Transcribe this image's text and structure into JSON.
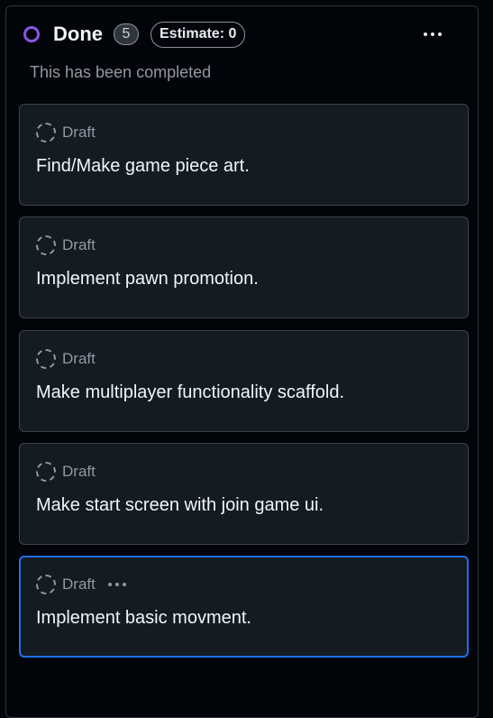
{
  "column": {
    "title": "Done",
    "count": "5",
    "estimate": "Estimate: 0",
    "description": "This has been completed",
    "status_color": "#8957e5"
  },
  "cards": [
    {
      "status": "Draft",
      "title": "Find/Make game piece art."
    },
    {
      "status": "Draft",
      "title": "Implement pawn promotion."
    },
    {
      "status": "Draft",
      "title": "Make multiplayer functionality scaffold."
    },
    {
      "status": "Draft",
      "title": "Make start screen with join game ui."
    },
    {
      "status": "Draft",
      "title": "Implement basic movment."
    }
  ]
}
